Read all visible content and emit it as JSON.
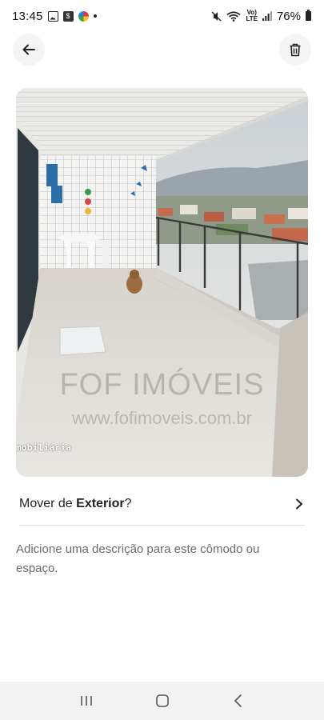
{
  "status_bar": {
    "time": "13:45",
    "network_label": "LTE",
    "network_sub": "Vo)",
    "battery": "76%"
  },
  "header": {
    "back_icon": "arrow-left-icon",
    "delete_icon": "trash-icon"
  },
  "photo": {
    "watermark_corner": "mobiliária",
    "watermark_brand": "FOF IMÓVEIS",
    "watermark_url": "www.fofimoveis.com.br"
  },
  "move_row": {
    "prefix": "Mover de ",
    "room": "Exterior",
    "suffix": "?"
  },
  "description": {
    "placeholder": "Adicione uma descrição para este cômodo ou espaço."
  },
  "nav_bar": {
    "recents_icon": "recents-icon",
    "home_icon": "home-icon",
    "back_icon": "nav-back-icon"
  },
  "colors": {
    "icon_button_bg": "#f4f4f4",
    "divider": "#dddddd",
    "secondary_text": "#6a6a6a"
  }
}
